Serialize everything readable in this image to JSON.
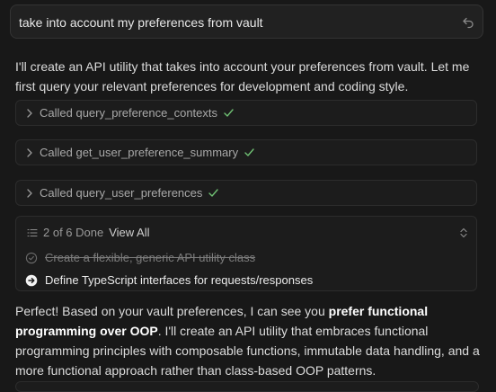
{
  "prompt": {
    "text": "take into account my preferences from vault"
  },
  "intro": "I'll create an API utility that takes into account your preferences from vault. Let me first query your relevant preferences for development and coding style.",
  "tool_calls": [
    {
      "label": "Called query_preference_contexts",
      "status": "done"
    },
    {
      "label": "Called get_user_preference_summary",
      "status": "done"
    },
    {
      "label": "Called query_user_preferences",
      "status": "done"
    }
  ],
  "todos": {
    "progress": "2 of 6 Done",
    "view_all": "View All",
    "items": [
      {
        "text": "Create a flexible, generic API utility class",
        "status": "done"
      },
      {
        "text": "Define TypeScript interfaces for requests/responses",
        "status": "in-progress"
      }
    ]
  },
  "reply": {
    "part1": "Perfect! Based on your vault preferences, I can see you ",
    "bold": "prefer functional programming over OOP",
    "part2": ". I'll create an API utility that embraces functional programming principles with composable functions, immutable data handling, and a more functional approach rather than class-based OOP patterns."
  },
  "colors": {
    "background": "#181818",
    "check": "#6fbf73",
    "muted_text": "#a9a9a9"
  }
}
